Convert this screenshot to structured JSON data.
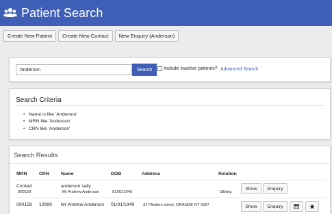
{
  "header": {
    "title": "Patient Search",
    "icon": "users-icon",
    "color": "#3f5fb7"
  },
  "toolbar": {
    "create_patient": "Create New Patient",
    "create_contact": "Create New Contact",
    "new_enquiry": "New Enquiry (Anderson)"
  },
  "search": {
    "value": "Anderson",
    "button": "Search",
    "include_inactive": "Include inactive patients?",
    "include_inactive_checked": false,
    "advanced": "Advanced Search"
  },
  "criteria": {
    "title": "Search Criteria",
    "items": [
      "Name is like 'Anderson'",
      "MRN like 'Anderson'",
      "CRN like 'Anderson'"
    ]
  },
  "results": {
    "title": "Search Results",
    "columns": {
      "mrn": "MRN",
      "crn": "CRN",
      "name": "Name",
      "dob": "DOB",
      "address": "Address",
      "relation": "Relation"
    },
    "rows": [
      {
        "mrn_line1": "Contact",
        "mrn_line2": "000159",
        "crn": "",
        "name_line1": "anderson sally",
        "name_line2": "Mr Andrew Anderson",
        "dob": "01/01/1949",
        "address": "",
        "relation": "Sibling",
        "show": "Show",
        "enquiry": "Enquiry"
      },
      {
        "mrn": "000159",
        "crn": "10999",
        "name": "Mr Andrew Anderson",
        "dob": "01/01/1949",
        "address": "31 Flinders street, ORANGE NT 5007",
        "relation": "",
        "show": "Show",
        "enquiry": "Enquiry",
        "icon1": "calendar-icon",
        "icon2": "star-icon"
      }
    ]
  }
}
